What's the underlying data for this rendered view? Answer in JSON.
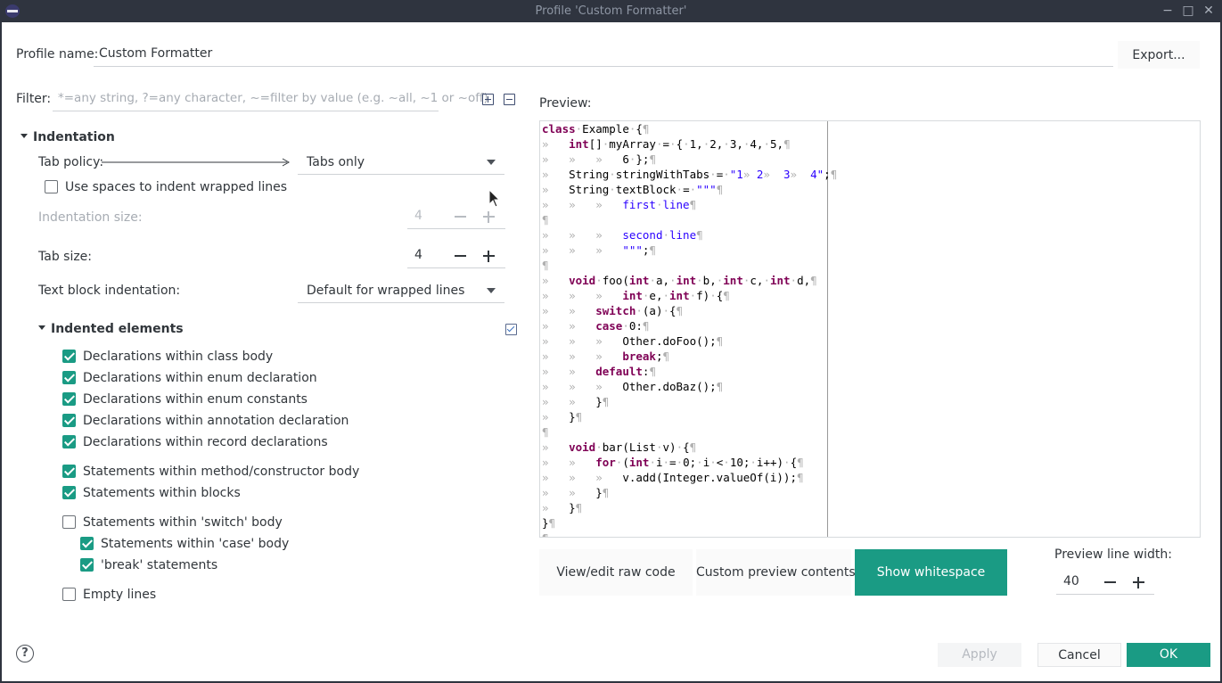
{
  "window": {
    "title": "Profile 'Custom Formatter'"
  },
  "profile": {
    "label": "Profile name:",
    "value": "Custom Formatter",
    "export_label": "Export..."
  },
  "filter": {
    "label": "Filter:",
    "placeholder": "*=any string, ?=any character, ~=filter by value (e.g. ~all, ~1 or ~off)"
  },
  "indentation": {
    "heading": "Indentation",
    "tab_policy_label": "Tab policy:",
    "tab_policy_value": "Tabs only",
    "use_spaces_label": "Use spaces to indent wrapped lines",
    "use_spaces_checked": false,
    "indent_size_label": "Indentation size:",
    "indent_size_value": "4",
    "tab_size_label": "Tab size:",
    "tab_size_value": "4",
    "text_block_label": "Text block indentation:",
    "text_block_value": "Default for wrapped lines"
  },
  "indented_elements": {
    "heading": "Indented elements",
    "items": [
      {
        "label": "Declarations within class body",
        "checked": true
      },
      {
        "label": "Declarations within enum declaration",
        "checked": true
      },
      {
        "label": "Declarations within enum constants",
        "checked": true
      },
      {
        "label": "Declarations within annotation declaration",
        "checked": true
      },
      {
        "label": "Declarations within record declarations",
        "checked": true
      },
      {
        "label": "Statements within method/constructor body",
        "checked": true
      },
      {
        "label": "Statements within blocks",
        "checked": true
      },
      {
        "label": "Statements within 'switch' body",
        "checked": false
      },
      {
        "label": "Statements within 'case' body",
        "checked": true
      },
      {
        "label": "'break' statements",
        "checked": true
      },
      {
        "label": "Empty lines",
        "checked": false
      }
    ]
  },
  "preview": {
    "label": "Preview:",
    "buttons": {
      "raw": "View/edit raw code",
      "custom": "Custom preview contents",
      "whitespace": "Show whitespace"
    },
    "line_width_label": "Preview line width:",
    "line_width_value": "40"
  },
  "footer": {
    "apply": "Apply",
    "cancel": "Cancel",
    "ok": "OK"
  },
  "colors": {
    "accent": "#1a9b84",
    "keyword": "#7f0055",
    "string": "#2a00ff"
  }
}
